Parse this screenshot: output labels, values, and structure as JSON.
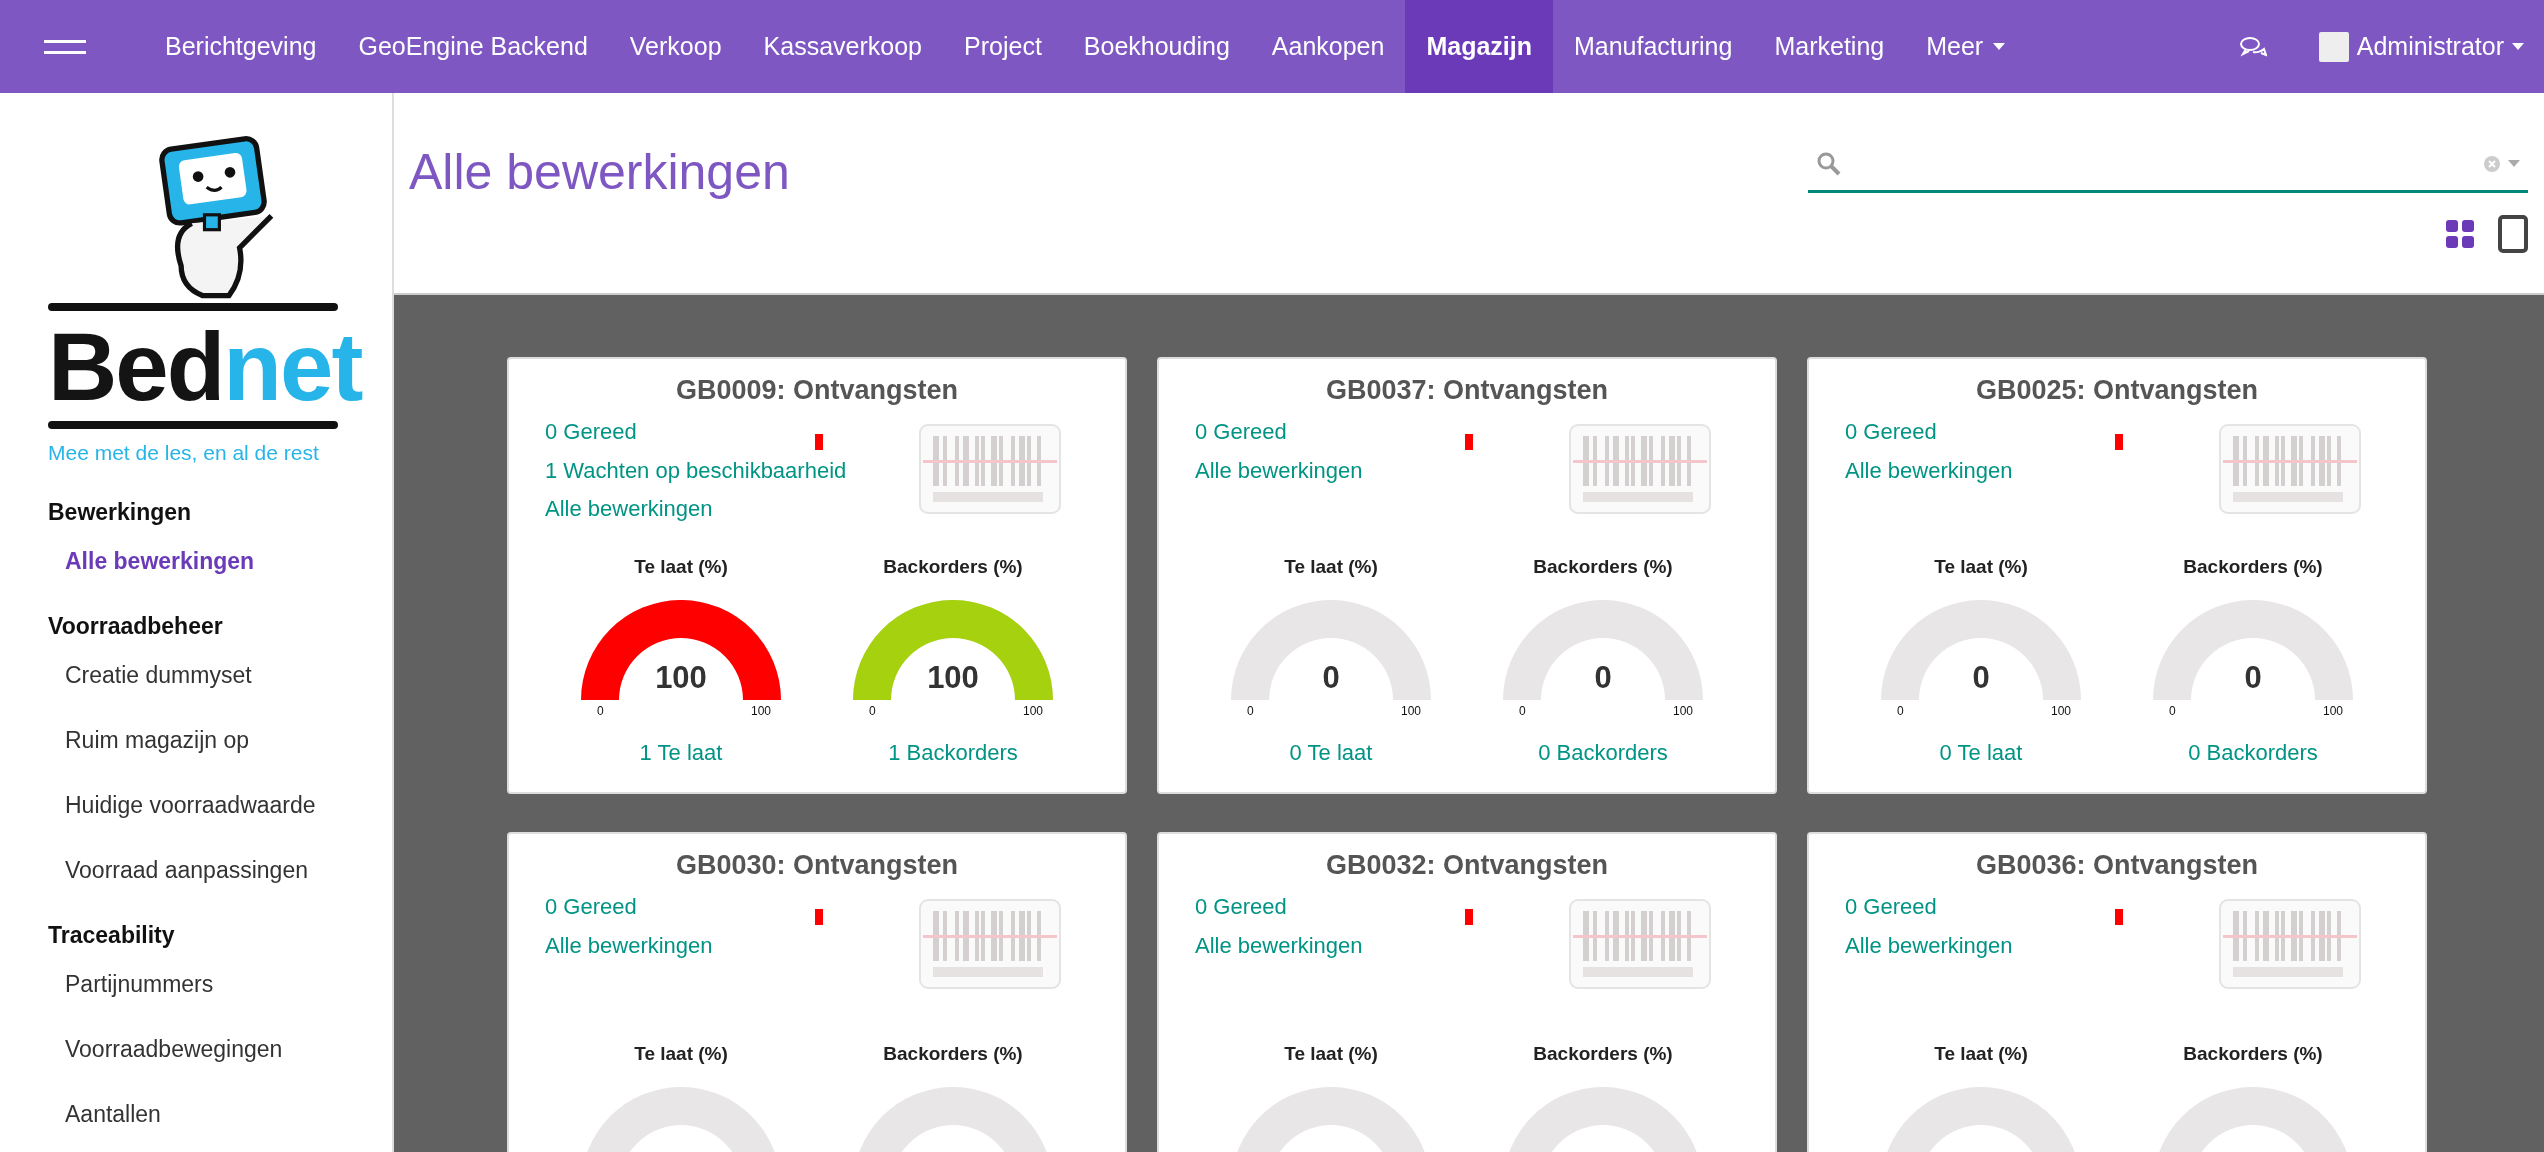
{
  "nav": {
    "items": [
      {
        "label": "Berichtgeving",
        "selected": false
      },
      {
        "label": "GeoEngine Backend",
        "selected": false
      },
      {
        "label": "Verkoop",
        "selected": false
      },
      {
        "label": "Kassaverkoop",
        "selected": false
      },
      {
        "label": "Project",
        "selected": false
      },
      {
        "label": "Boekhouding",
        "selected": false
      },
      {
        "label": "Aankopen",
        "selected": false
      },
      {
        "label": "Magazijn",
        "selected": true
      },
      {
        "label": "Manufacturing",
        "selected": false
      },
      {
        "label": "Marketing",
        "selected": false
      }
    ],
    "more": "Meer",
    "user": "Administrator"
  },
  "sidebar": {
    "logo": {
      "wordmark": [
        "Bed",
        "net"
      ],
      "tagline": "Mee met de les, en al de rest"
    },
    "sections": [
      {
        "title": "Bewerkingen",
        "items": [
          {
            "label": "Alle bewerkingen",
            "selected": true
          }
        ]
      },
      {
        "title": "Voorraadbeheer",
        "items": [
          {
            "label": "Creatie dummyset",
            "selected": false
          },
          {
            "label": "Ruim magazijn op",
            "selected": false
          },
          {
            "label": "Huidige voorraadwaarde",
            "selected": false
          },
          {
            "label": "Voorraad aanpassingen",
            "selected": false
          }
        ]
      },
      {
        "title": "Traceability",
        "items": [
          {
            "label": "Partijnummers",
            "selected": false
          },
          {
            "label": "Voorraadbewegingen",
            "selected": false
          },
          {
            "label": "Aantallen",
            "selected": false
          }
        ]
      }
    ]
  },
  "header": {
    "title": "Alle bewerkingen"
  },
  "cards": [
    {
      "title": "GB0009: Ontvangsten",
      "color": "#ff0000",
      "links": [
        "0 Gereed",
        "1 Wachten op beschikbaarheid",
        "Alle bewerkingen"
      ],
      "gauges": [
        {
          "title": "Te laat (%)",
          "level": 1,
          "color": "#ff0000",
          "value": "100",
          "min": "0",
          "max": "100",
          "footer": "1 Te laat"
        },
        {
          "title": "Backorders (%)",
          "level": 1,
          "color": "#a6d10f",
          "value": "100",
          "min": "0",
          "max": "100",
          "footer": "1 Backorders"
        }
      ]
    },
    {
      "title": "GB0037: Ontvangsten",
      "color": "#ff0000",
      "links": [
        "0 Gereed",
        "Alle bewerkingen"
      ],
      "gauges": [
        {
          "title": "Te laat (%)",
          "level": 0,
          "value": "0",
          "min": "0",
          "max": "100",
          "footer": "0 Te laat"
        },
        {
          "title": "Backorders (%)",
          "level": 0,
          "value": "0",
          "min": "0",
          "max": "100",
          "footer": "0 Backorders"
        }
      ]
    },
    {
      "title": "GB0025: Ontvangsten",
      "color": "#ff0000",
      "links": [
        "0 Gereed",
        "Alle bewerkingen"
      ],
      "gauges": [
        {
          "title": "Te laat (%)",
          "level": 0,
          "value": "0",
          "min": "0",
          "max": "100",
          "footer": "0 Te laat"
        },
        {
          "title": "Backorders (%)",
          "level": 0,
          "value": "0",
          "min": "0",
          "max": "100",
          "footer": "0 Backorders"
        }
      ]
    },
    {
      "title": "GB0030: Ontvangsten",
      "color": "#ff0000",
      "links": [
        "0 Gereed",
        "Alle bewerkingen"
      ],
      "gauges": [
        {
          "title": "Te laat (%)"
        },
        {
          "title": "Backorders (%)"
        }
      ]
    },
    {
      "title": "GB0032: Ontvangsten",
      "color": "#ff0000",
      "links": [
        "0 Gereed",
        "Alle bewerkingen"
      ],
      "gauges": [
        {
          "title": "Te laat (%)"
        },
        {
          "title": "Backorders (%)"
        }
      ]
    },
    {
      "title": "GB0036: Ontvangsten",
      "color": "#ff0000",
      "links": [
        "0 Gereed",
        "Alle bewerkingen"
      ],
      "gauges": [
        {
          "title": "Te laat (%)"
        },
        {
          "title": "Backorders (%)"
        }
      ]
    }
  ]
}
